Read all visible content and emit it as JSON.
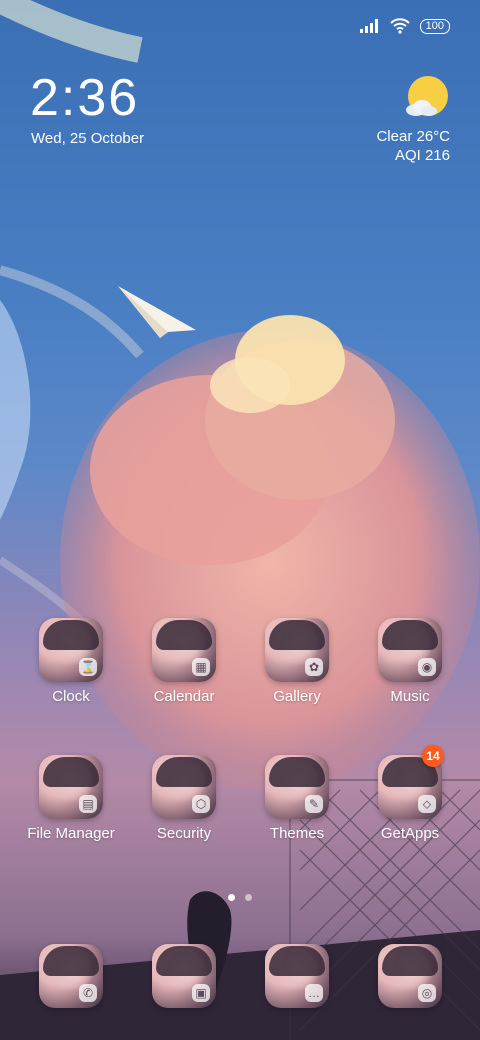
{
  "status_bar": {
    "battery": "100",
    "signal_icon": "signal-icon",
    "wifi_icon": "wifi-icon"
  },
  "widget": {
    "time": "2:36",
    "date": "Wed, 25 October"
  },
  "weather": {
    "condition_temp": "Clear  26°C",
    "aqi": "AQI 216",
    "icon": "sun-cloud-icon"
  },
  "apps": [
    {
      "label": "Clock",
      "glyph": "⌛"
    },
    {
      "label": "Calendar",
      "glyph": "▦"
    },
    {
      "label": "Gallery",
      "glyph": "✿"
    },
    {
      "label": "Music",
      "glyph": "◉"
    },
    {
      "label": "File Manager",
      "glyph": "▤"
    },
    {
      "label": "Security",
      "glyph": "⬡"
    },
    {
      "label": "Themes",
      "glyph": "✎"
    },
    {
      "label": "GetApps",
      "glyph": "⬦",
      "badge": "14"
    }
  ],
  "dock": [
    {
      "glyph": "✆"
    },
    {
      "glyph": "▣"
    },
    {
      "glyph": "…"
    },
    {
      "glyph": "◎"
    }
  ],
  "colors": {
    "accent_badge": "#ff5a1f"
  }
}
